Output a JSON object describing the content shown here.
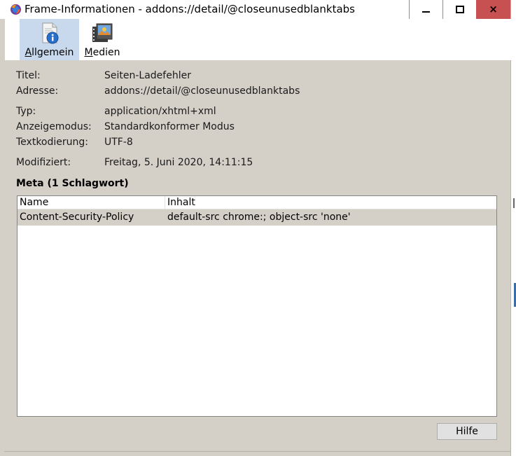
{
  "window": {
    "title": "Frame-Informationen - addons://detail/@closeunusedblanktabs",
    "minimize_glyph": "",
    "maximize_glyph": "",
    "close_glyph": "×"
  },
  "toolbar": {
    "general": {
      "accel": "A",
      "rest": "llgemein",
      "icon": "info-page-icon"
    },
    "media": {
      "accel": "M",
      "rest": "edien",
      "icon": "media-pictures-icon"
    }
  },
  "info": {
    "title_label": "Titel:",
    "title_value": "Seiten-Ladefehler",
    "address_label": "Adresse:",
    "address_value": "addons://detail/@closeunusedblanktabs",
    "type_label": "Typ:",
    "type_value": "application/xhtml+xml",
    "mode_label": "Anzeigemodus:",
    "mode_value": "Standardkonformer Modus",
    "encoding_label": "Textkodierung:",
    "encoding_value": "UTF-8",
    "modified_label": "Modifiziert:",
    "modified_value": "Freitag, 5. Juni 2020, 14:11:15"
  },
  "meta": {
    "title": "Meta (1 Schlagwort)",
    "columns": [
      "Name",
      "Inhalt"
    ],
    "rows": [
      {
        "name": "Content-Security-Policy",
        "content": "default-src chrome:; object-src 'none'"
      }
    ]
  },
  "buttons": {
    "help": "Hilfe"
  },
  "colors": {
    "dialog_bg": "#d4d0c8",
    "selected_tool_bg": "#c8d9ee",
    "close_button": "#c75050",
    "selected_row_bg": "#d4d0c8"
  }
}
